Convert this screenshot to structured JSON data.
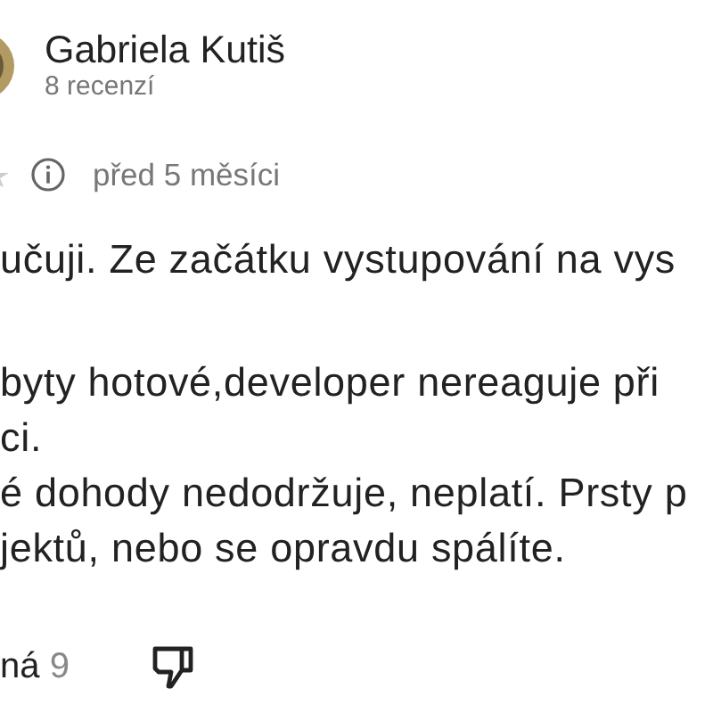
{
  "reviewer": {
    "name": "Gabriela Kutiš",
    "review_count": "8 recenzí"
  },
  "review": {
    "time": "před 5 měsíci",
    "paragraphs": [
      [
        "učuji. Ze začátku vystupování na vys"
      ],
      [
        "byty hotové,developer nereaguje při",
        "ci.",
        "é dohody nedodržuje, neplatí. Prsty p",
        "jektů, nebo se opravdu spálíte."
      ]
    ]
  },
  "actions": {
    "helpful_label": "ná",
    "helpful_count": "9"
  }
}
